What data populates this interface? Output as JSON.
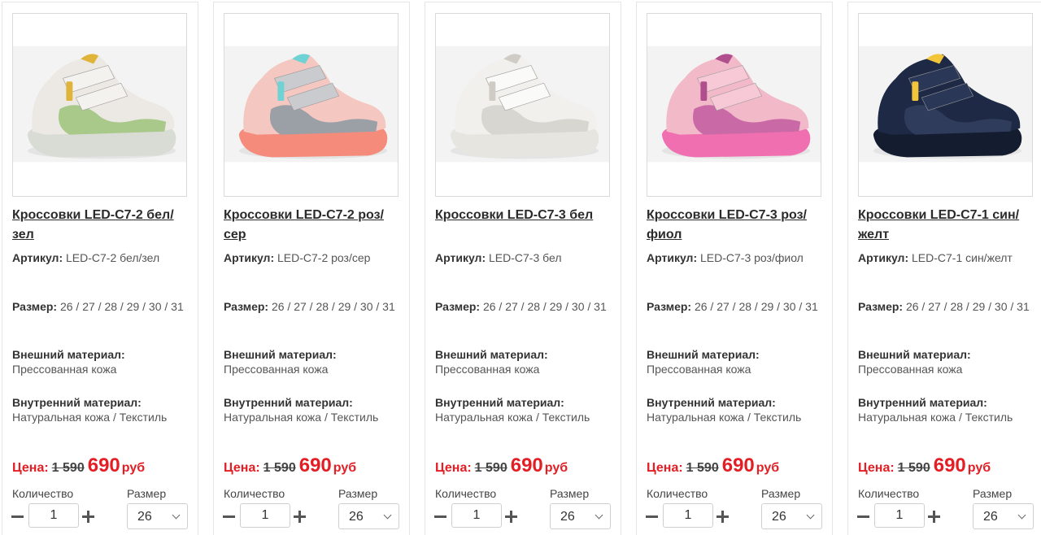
{
  "products": [
    {
      "title": "Кроссовки LED-C7-2 бел/зел",
      "article_label": "Артикул:",
      "article": "LED-C7-2 бел/зел",
      "size_label": "Размер:",
      "sizes": "26 / 27 / 28 / 29 / 30 / 31",
      "outer_label": "Внешний материал:",
      "outer": "Прессованная кожа",
      "inner_label": "Внутренний материал:",
      "inner": "Натуральная кожа / Текстиль",
      "price_label": "Цена:",
      "old_price": "1 590",
      "new_price": "690",
      "currency": "руб",
      "qty_label": "Количество",
      "qty": "1",
      "select_label": "Размер",
      "selected_size": "26",
      "image": {
        "icon": "sneaker-image",
        "upper": "#ece9e4",
        "accent": "#a8c98a",
        "sole": "#d9dbd5",
        "strap": "#f4f2ee",
        "badge": "#e0b43a"
      }
    },
    {
      "title": "Кроссовки LED-C7-2 роз/сер",
      "article_label": "Артикул:",
      "article": "LED-C7-2 роз/сер",
      "size_label": "Размер:",
      "sizes": "26 / 27 / 28 / 29 / 30 / 31",
      "outer_label": "Внешний материал:",
      "outer": "Прессованная кожа",
      "inner_label": "Внутренний материал:",
      "inner": "Натуральная кожа / Текстиль",
      "price_label": "Цена:",
      "old_price": "1 590",
      "new_price": "690",
      "currency": "руб",
      "qty_label": "Количество",
      "qty": "1",
      "select_label": "Размер",
      "selected_size": "26",
      "image": {
        "icon": "sneaker-image",
        "upper": "#f4c7c0",
        "accent": "#9aa0a6",
        "sole": "#f58b7a",
        "strap": "#c9cbcf",
        "badge": "#6fd3d6"
      }
    },
    {
      "title": "Кроссовки LED-C7-3 бел",
      "article_label": "Артикул:",
      "article": "LED-C7-3 бел",
      "size_label": "Размер:",
      "sizes": "26 / 27 / 28 / 29 / 30 / 31",
      "outer_label": "Внешний материал:",
      "outer": "Прессованная кожа",
      "inner_label": "Внутренний материал:",
      "inner": "Натуральная кожа / Текстиль",
      "price_label": "Цена:",
      "old_price": "1 590",
      "new_price": "690",
      "currency": "руб",
      "qty_label": "Количество",
      "qty": "1",
      "select_label": "Размер",
      "selected_size": "26",
      "image": {
        "icon": "sneaker-image",
        "upper": "#f1f0ec",
        "accent": "#d8d6d0",
        "sole": "#e6e5e0",
        "strap": "#fafaf8",
        "badge": "#cfccc5"
      }
    },
    {
      "title": "Кроссовки LED-C7-3 роз/фиол",
      "article_label": "Артикул:",
      "article": "LED-C7-3 роз/фиол",
      "size_label": "Размер:",
      "sizes": "26 / 27 / 28 / 29 / 30 / 31",
      "outer_label": "Внешний материал:",
      "outer": "Прессованная кожа",
      "inner_label": "Внутренний материал:",
      "inner": "Натуральная кожа / Текстиль",
      "price_label": "Цена:",
      "old_price": "1 590",
      "new_price": "690",
      "currency": "руб",
      "qty_label": "Количество",
      "qty": "1",
      "select_label": "Размер",
      "selected_size": "26",
      "image": {
        "icon": "sneaker-image",
        "upper": "#f2b9c8",
        "accent": "#c96aa6",
        "sole": "#f06fb0",
        "strap": "#f7c9d6",
        "badge": "#b04f8e"
      }
    },
    {
      "title": "Кроссовки LED-C7-1 син/желт",
      "article_label": "Артикул:",
      "article": "LED-C7-1 син/желт",
      "size_label": "Размер:",
      "sizes": "26 / 27 / 28 / 29 / 30 / 31",
      "outer_label": "Внешний материал:",
      "outer": "Прессованная кожа",
      "inner_label": "Внутренний материал:",
      "inner": "Натуральная кожа / Текстиль",
      "price_label": "Цена:",
      "old_price": "1 590",
      "new_price": "690",
      "currency": "руб",
      "qty_label": "Количество",
      "qty": "1",
      "select_label": "Размер",
      "selected_size": "26",
      "image": {
        "icon": "sneaker-image",
        "upper": "#1e2a45",
        "accent": "#2f3c5c",
        "sole": "#141c30",
        "strap": "#2a3756",
        "badge": "#f2c53a"
      }
    }
  ],
  "colors": {
    "price_red": "#e31e24",
    "border": "#e6e6e6",
    "text": "#333333"
  }
}
